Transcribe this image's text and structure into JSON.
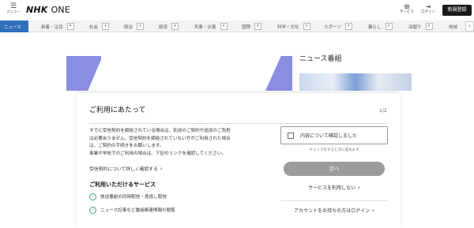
{
  "header": {
    "menu_icon": "hamburger-icon",
    "menu_label": "メニュー",
    "logo_nhk": "NHK",
    "logo_one": "ONE",
    "services_icon": "grid-icon",
    "services_label": "サービス",
    "login_icon": "login-icon",
    "login_label": "ログイン",
    "signup_label": "新規登録"
  },
  "nav": {
    "active_color": "#2f6fbe",
    "items": [
      {
        "label": "ニュース"
      },
      {
        "label": "新着・注目"
      },
      {
        "label": "社会"
      },
      {
        "label": "政治"
      },
      {
        "label": "経済"
      },
      {
        "label": "気象・災害"
      },
      {
        "label": "国際"
      },
      {
        "label": "科学・文化"
      },
      {
        "label": "スポーツ"
      },
      {
        "label": "暮らし"
      },
      {
        "label": "深掘り"
      },
      {
        "label": "地域"
      }
    ],
    "more_icon": "chevron-right-icon"
  },
  "background": {
    "section_title": "ニュース番組"
  },
  "modal": {
    "title": "ご利用にあたって",
    "page_indicator": "1/2",
    "body_lines": [
      "すでに受信契約を締結されている場合は、別途のご契約や追加のご負担",
      "は必要ありません。受信契約を締結されていない方がご利用された場合",
      "は、ご契約の手続きをお願いします。",
      "事業や学校でのご利用の場合は、下記のリンクを確認してください。"
    ],
    "detail_link": "受信契約について詳しく確認する",
    "services_heading": "ご利用いただけるサービス",
    "features": [
      "放送番組の同時配信・見逃し配信",
      "ニュース記事など番組関連情報の閲覧"
    ],
    "agree_label": "内容について確認しました",
    "agree_note": "チェックをすると次に進めます",
    "next_label": "次へ",
    "no_use_label": "サービスを利用しない",
    "login_prompt": "アカウントをお持ちの方はログイン",
    "accent_color": "#39a86b",
    "next_color": "#9b9b9b"
  }
}
